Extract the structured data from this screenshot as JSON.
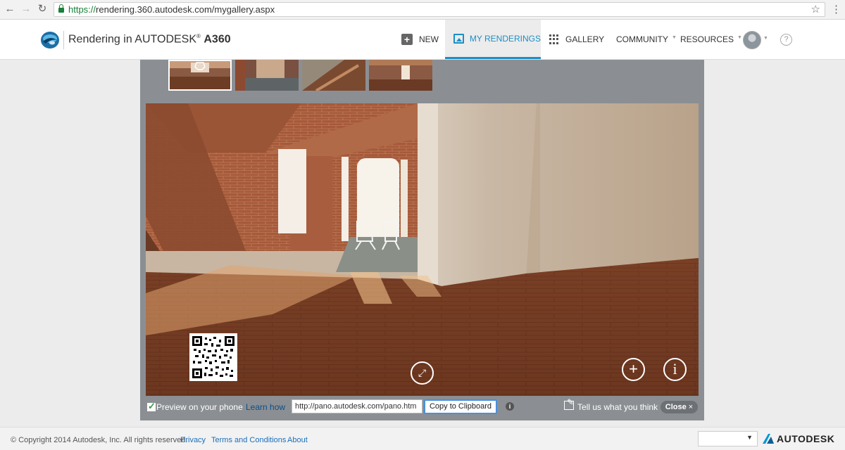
{
  "browser": {
    "url_protocol": "https://",
    "url_rest": "rendering.360.autodesk.com/mygallery.aspx"
  },
  "header": {
    "brand_prefix": "Rendering in AUTODESK",
    "brand_reg": "®",
    "brand_product": "A360",
    "nav": [
      {
        "label": "NEW",
        "icon": "plus-box-icon",
        "active": false
      },
      {
        "label": "MY RENDERINGS",
        "icon": "image-icon",
        "active": true
      },
      {
        "label": "GALLERY",
        "icon": "grid-icon",
        "active": false
      },
      {
        "label": "COMMUNITY",
        "has_caret": true,
        "active": false
      },
      {
        "label": "RESOURCES",
        "has_caret": true,
        "active": false
      }
    ],
    "help_label": "?",
    "accent_color": "#1a8fc7"
  },
  "viewer": {
    "thumbnails_count": 4,
    "selected_thumbnail": 0,
    "share": {
      "preview_label": "Preview on your phone",
      "learn_link": "Learn how",
      "pano_url": "http://pano.autodesk.com/pano.htm",
      "copy_button": "Copy to Clipboard",
      "info_label": "i",
      "feedback_label": "Tell us what you think",
      "close_label": "Close",
      "close_x": "×"
    },
    "zoom_in_label": "+",
    "info_label": "i"
  },
  "footer": {
    "copyright": "© Copyright 2014 Autodesk, Inc. All rights reserved.",
    "links": [
      "Privacy",
      "Terms and Conditions",
      "About"
    ],
    "logo_text": "AUTODESK"
  }
}
